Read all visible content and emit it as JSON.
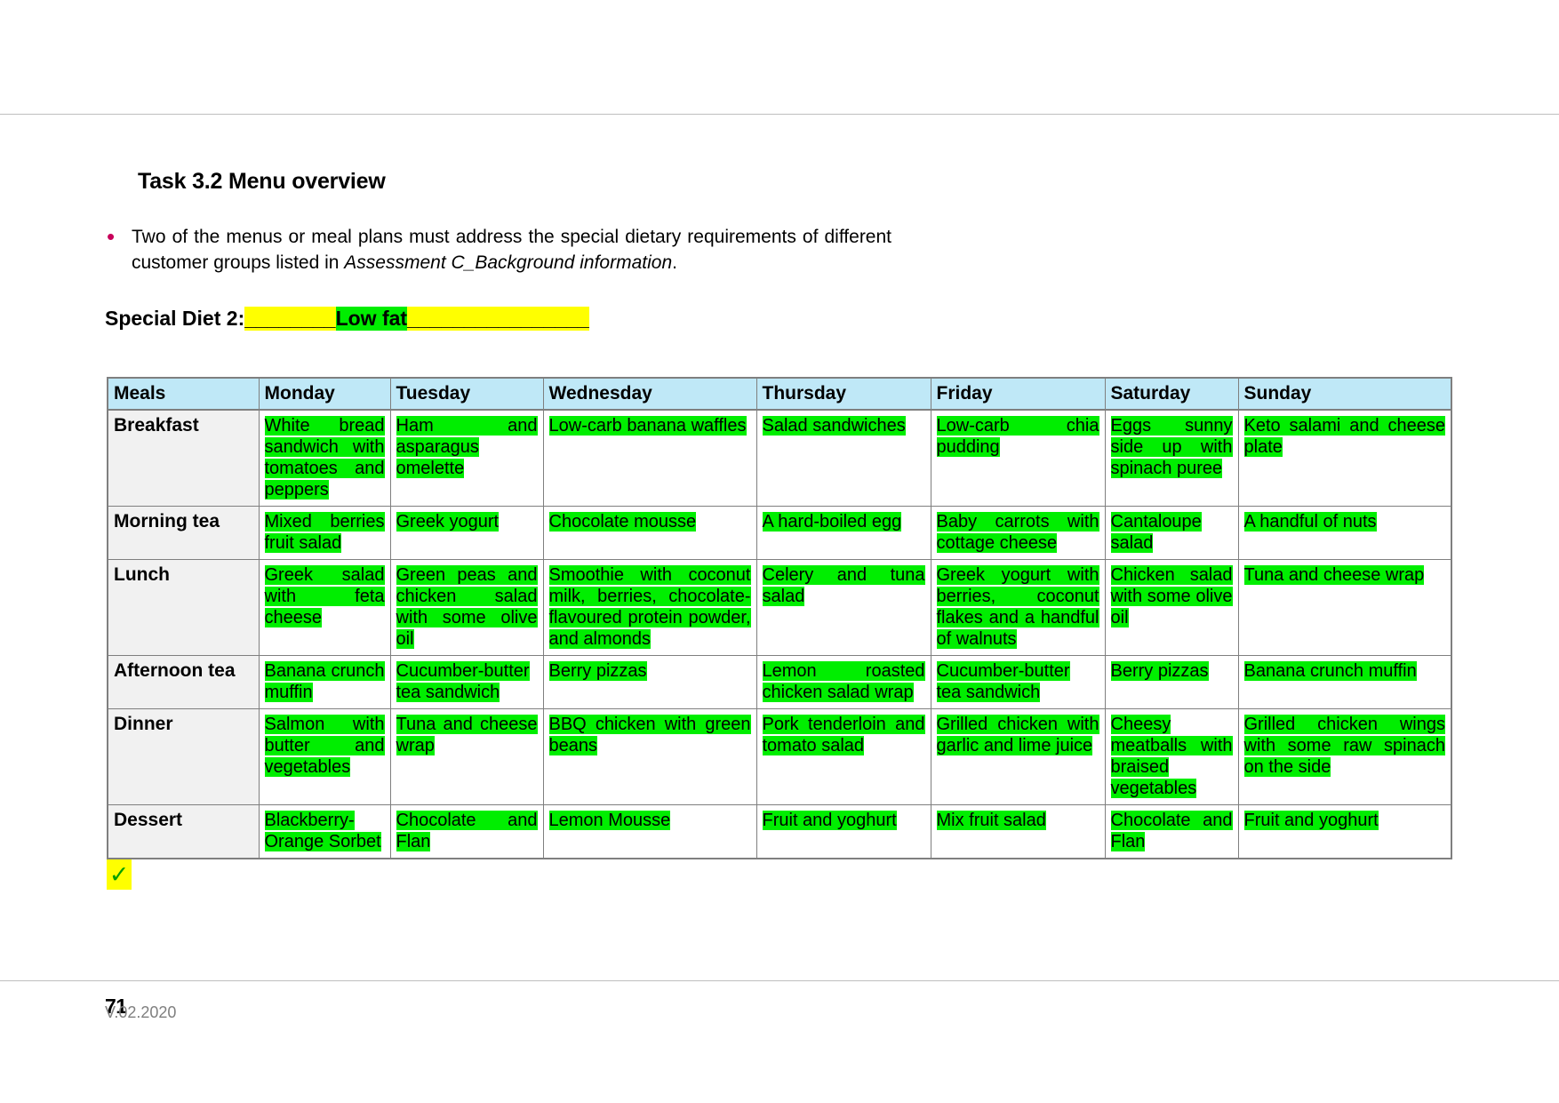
{
  "page": {
    "task_title": "Task 3.2 Menu overview",
    "bullet": {
      "text_before": "Two of the menus or meal plans must address the special dietary requirements of different customer groups listed in ",
      "italic_text": "Assessment C_Background information",
      "text_after": "."
    },
    "diet": {
      "label": "Special Diet 2:",
      "blank_before": "________",
      "value": "Low fat",
      "blank_after": "________________",
      "highlight_yellow": "#ffff00",
      "highlight_green": "#00ee00"
    },
    "check_mark": "✓",
    "footer": {
      "page_number": "71",
      "version": "V.02.2020"
    }
  },
  "table": {
    "header_background": "#bfe8f7",
    "columns": [
      "Meals",
      "Monday",
      "Tuesday",
      "Wednesday",
      "Thursday",
      "Friday",
      "Saturday",
      "Sunday"
    ],
    "rows": [
      {
        "meal": "Breakfast",
        "cells": [
          "White bread sandwich with tomatoes and peppers",
          "Ham and asparagus omelette",
          "Low-carb banana waffles",
          "Salad sandwiches",
          "Low-carb chia pudding",
          "Eggs sunny side up with spinach puree",
          "Keto salami and cheese plate"
        ]
      },
      {
        "meal": "Morning tea",
        "cells": [
          "Mixed berries fruit salad",
          "Greek yogurt",
          "Chocolate mousse",
          "A hard-boiled egg",
          "Baby carrots with cottage cheese",
          "Cantaloupe salad",
          "A handful of nuts"
        ]
      },
      {
        "meal": "Lunch",
        "cells": [
          "Greek salad with feta cheese",
          "Green peas and chicken salad with some olive oil",
          "Smoothie with coconut milk, berries, chocolate-flavoured protein powder, and almonds",
          "Celery and tuna salad",
          "Greek yogurt with berries, coconut flakes and a handful of walnuts",
          "Chicken salad with some olive oil",
          "Tuna and cheese wrap"
        ]
      },
      {
        "meal": "Afternoon tea",
        "cells": [
          "Banana crunch muffin",
          "Cucumber-butter tea sandwich",
          "Berry pizzas",
          "Lemon roasted chicken salad wrap",
          "Cucumber-butter tea sandwich",
          "Berry pizzas",
          "Banana crunch muffin"
        ]
      },
      {
        "meal": "Dinner",
        "cells": [
          "Salmon with butter and vegetables",
          "Tuna and cheese wrap",
          "BBQ chicken with green beans",
          "Pork tenderloin and tomato salad",
          "Grilled chicken with garlic and lime juice",
          "Cheesy meatballs with braised vegetables",
          "Grilled chicken wings with some raw spinach on the side"
        ]
      },
      {
        "meal": "Dessert",
        "cells": [
          "Blackberry-Orange Sorbet",
          "Chocolate and Flan",
          "Lemon Mousse",
          "Fruit and yoghurt",
          "Mix fruit salad",
          "Chocolate and Flan",
          "Fruit and yoghurt"
        ]
      }
    ]
  }
}
